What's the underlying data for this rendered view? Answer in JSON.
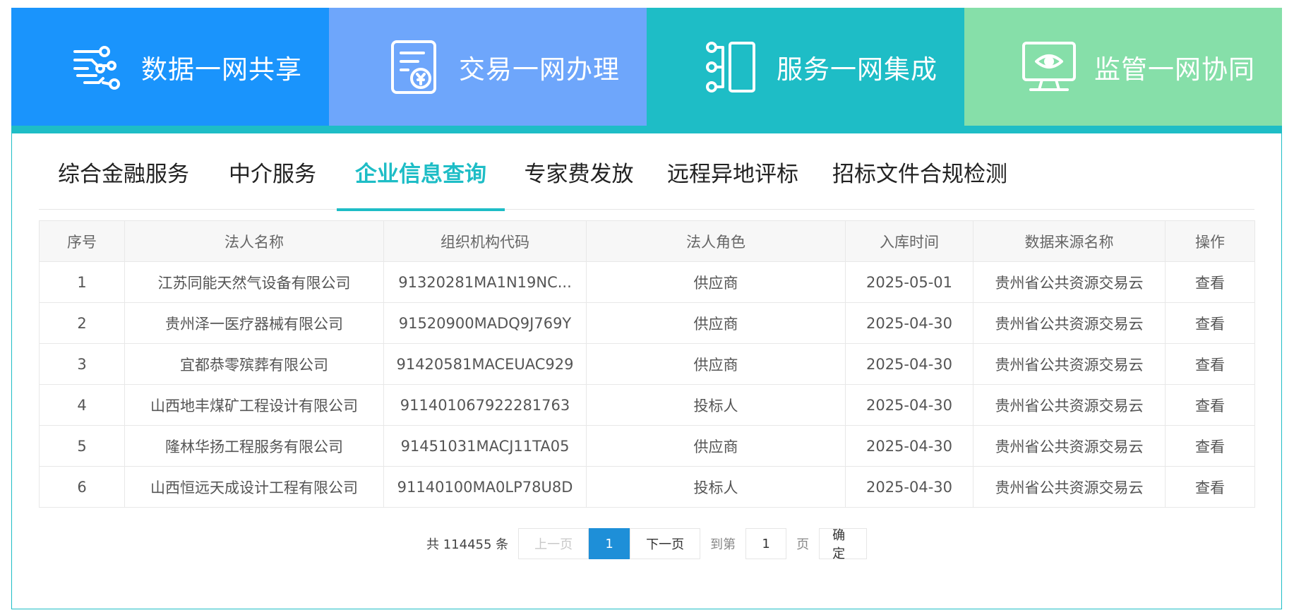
{
  "banner": [
    {
      "label": "数据一网共享",
      "color": "#1a94fc",
      "icon": "data-network-icon"
    },
    {
      "label": "交易一网办理",
      "color": "#6ea6fb",
      "icon": "transaction-document-icon"
    },
    {
      "label": "服务一网集成",
      "color": "#1ebdc6",
      "icon": "service-integration-icon"
    },
    {
      "label": "监管一网协同",
      "color": "#86dfa9",
      "icon": "monitor-eye-icon"
    }
  ],
  "tabs": [
    {
      "label": "综合金融服务",
      "active": false
    },
    {
      "label": "中介服务",
      "active": false
    },
    {
      "label": "企业信息查询",
      "active": true
    },
    {
      "label": "专家费发放",
      "active": false
    },
    {
      "label": "远程异地评标",
      "active": false
    },
    {
      "label": "招标文件合规检测",
      "active": false
    }
  ],
  "table": {
    "headers": [
      "序号",
      "法人名称",
      "组织机构代码",
      "法人角色",
      "入库时间",
      "数据来源名称",
      "操作"
    ],
    "rows": [
      [
        "1",
        "江苏同能天然气设备有限公司",
        "91320281MA1N19NC...",
        "供应商",
        "2025-05-01",
        "贵州省公共资源交易云",
        "查看"
      ],
      [
        "2",
        "贵州泽一医疗器械有限公司",
        "91520900MADQ9J769Y",
        "供应商",
        "2025-04-30",
        "贵州省公共资源交易云",
        "查看"
      ],
      [
        "3",
        "宜都恭零殡葬有限公司",
        "91420581MACEUAC929",
        "供应商",
        "2025-04-30",
        "贵州省公共资源交易云",
        "查看"
      ],
      [
        "4",
        "山西地丰煤矿工程设计有限公司",
        "911401067922281763",
        "投标人",
        "2025-04-30",
        "贵州省公共资源交易云",
        "查看"
      ],
      [
        "5",
        "隆林华扬工程服务有限公司",
        "91451031MACJ11TA05",
        "供应商",
        "2025-04-30",
        "贵州省公共资源交易云",
        "查看"
      ],
      [
        "6",
        "山西恒远天成设计工程有限公司",
        "91140100MA0LP78U8D",
        "投标人",
        "2025-04-30",
        "贵州省公共资源交易云",
        "查看"
      ]
    ]
  },
  "pager": {
    "total_text": "共 114455 条",
    "prev_label": "上一页",
    "current_page": "1",
    "next_label": "下一页",
    "goto_label": "到第",
    "page_input_value": "1",
    "unit_label": "页",
    "confirm_label": "确定",
    "accent": "#1e8fd8"
  }
}
